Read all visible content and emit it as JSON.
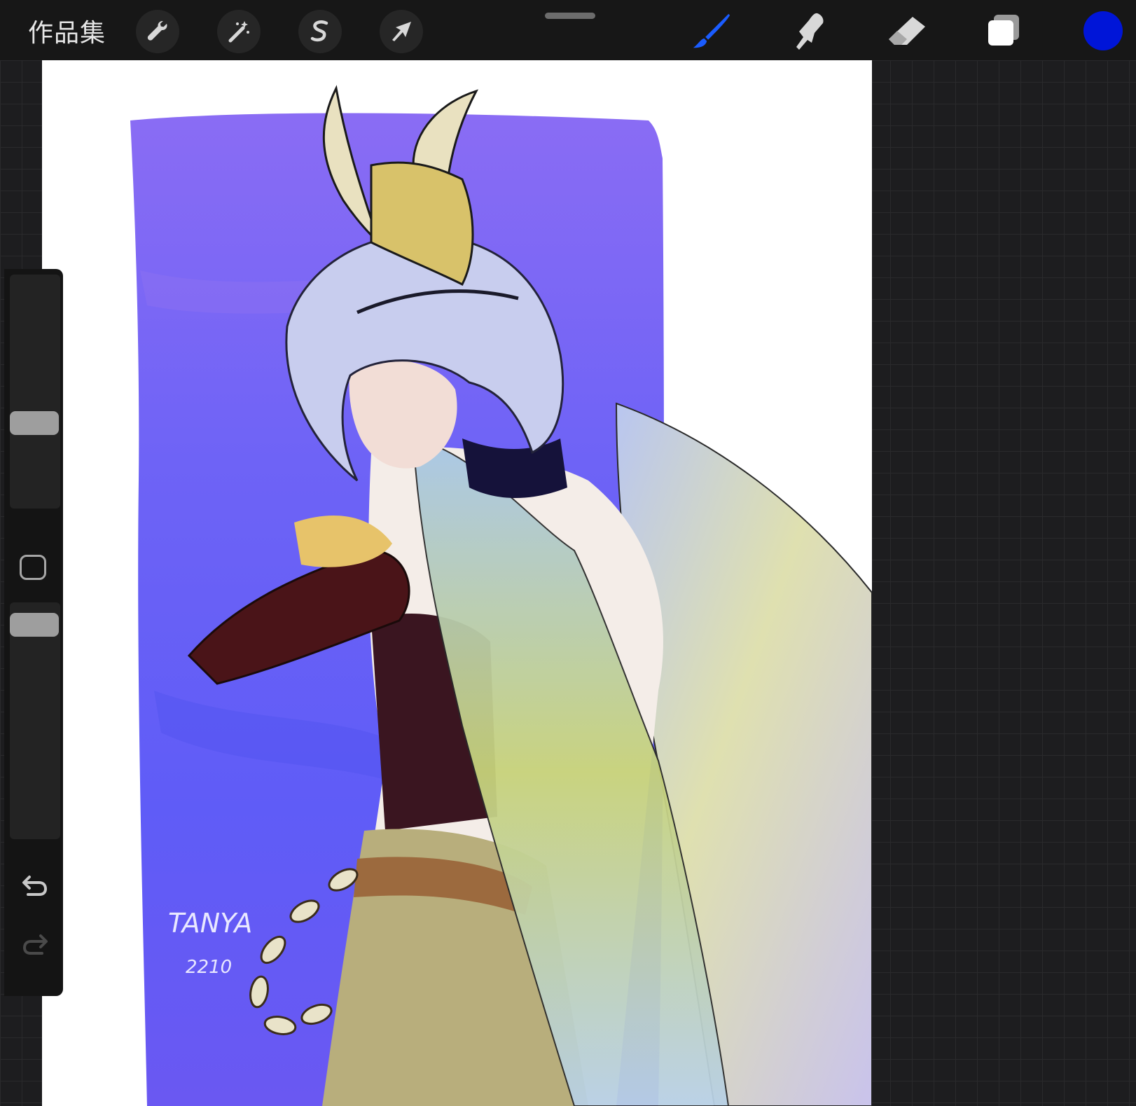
{
  "toolbar": {
    "gallery_label": "作品集",
    "left_tools": [
      {
        "name": "wrench-icon",
        "label": "actions"
      },
      {
        "name": "magic-wand-icon",
        "label": "adjustments"
      },
      {
        "name": "selection-s-icon",
        "label": "selection"
      },
      {
        "name": "arrow-cursor-icon",
        "label": "transform"
      }
    ],
    "right_tools": [
      {
        "name": "brush-icon",
        "label": "paint",
        "active": true
      },
      {
        "name": "smudge-icon",
        "label": "smudge"
      },
      {
        "name": "eraser-icon",
        "label": "erase"
      },
      {
        "name": "layers-icon",
        "label": "layers"
      }
    ],
    "current_color": "#0015d8",
    "accent_color": "#1a5cff"
  },
  "canvas": {
    "signature": "TANYA",
    "signature_date": "2210",
    "background_color": "#ffffff"
  },
  "sidebar": {
    "brush_size_level": 0.35,
    "opacity_level": 0.95,
    "undo_label": "undo",
    "redo_label": "redo"
  }
}
